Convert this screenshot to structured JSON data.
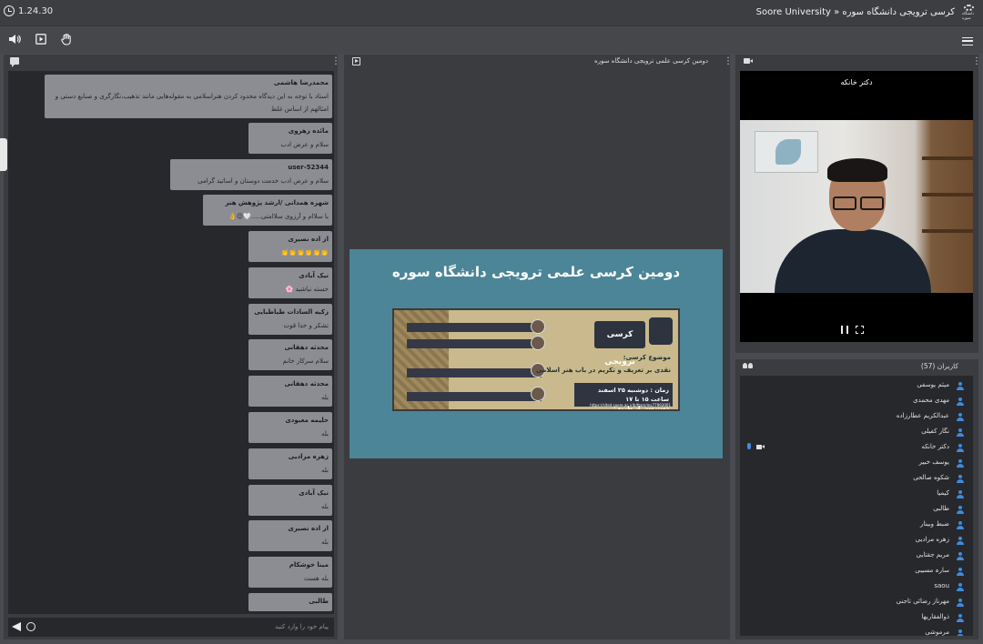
{
  "topbar": {
    "timer": "1.24.30",
    "title": "Soore University » کرسی ترویجی دانشگاه سوره",
    "logo_caption": "دانشگاه سوره"
  },
  "toolbar": {
    "speaker_icon": "speaker-icon",
    "share_icon": "screen-share-icon",
    "hand_icon": "raise-hand-icon",
    "menu_icon": "menu-icon"
  },
  "chat": {
    "input_placeholder": "پیام خود را وارد کنید",
    "messages": [
      {
        "sender": "محمدرضا هاشمی",
        "text": "استاد با توجه به این دیدگاه محدود کردن هنراسلامی به مقوله‌هایی مانند تذهیب،نگارگری و صنایع دستی و امثالهم از اساس غلط"
      },
      {
        "sender": "مائده زهروی",
        "text": "سلام و عرض ادب"
      },
      {
        "sender": "user-52344",
        "text": "سلام و عرض ادب خدمت دوستان و اساتید گرامی"
      },
      {
        "sender": "شهره همدانی /ارشد پژوهش هنر",
        "text": "با سلاام و آرزوی سلاامتی.....🤍😌👌"
      },
      {
        "sender": "از اده نصیری",
        "text": "👏👏👏👏👏👏"
      },
      {
        "sender": "نیک آبادی",
        "text": "خسته نباشید 🌸"
      },
      {
        "sender": "زکیه السادات طباطبایی",
        "text": "تشکر و خدا قوت"
      },
      {
        "sender": "محدثه دهقانی",
        "text": "سلام سرکار خانم"
      },
      {
        "sender": "محدثه دهقانی",
        "text": "بله"
      },
      {
        "sender": "حلیمه معبودی",
        "text": "بله"
      },
      {
        "sender": "زهره مرادیی",
        "text": "بله"
      },
      {
        "sender": "نیک آبادی",
        "text": "بله"
      },
      {
        "sender": "از اده نصیری",
        "text": "بله"
      },
      {
        "sender": "مینا خوشکام",
        "text": "بله هست"
      },
      {
        "sender": "طالبی",
        "text": ""
      }
    ]
  },
  "presentation": {
    "title": "دومین کرسی علمی ترویجی دانشگاه سوره",
    "slide_title": "دومین کرسی علمی ترویجی دانشگاه سوره",
    "banner_heading": "کرسی ترویجی",
    "banner_subject": "موضوع کرسی:",
    "banner_topic": "نقدی بر تعریف و تکریم در باب هنر اسلامی",
    "banner_time": "زمان : دوشنبه ۲۵ اسفند ساعت ۱۵ تا ۱۷",
    "banner_access": "دسترسی از طریق:",
    "banner_link": "https://slted.soore.ac.ir/b/ttam/ms77993001"
  },
  "webcam": {
    "name": "دکتر خانکه"
  },
  "users": {
    "title": "کاربران (57)",
    "list": [
      {
        "name": "میثم یوسفی",
        "has_av": false
      },
      {
        "name": "مهدی محمدی",
        "has_av": false
      },
      {
        "name": "عبدالکریم عطارزاده",
        "has_av": false
      },
      {
        "name": "نگار کفیلی",
        "has_av": false
      },
      {
        "name": "دکتر خانکه",
        "has_av": true
      },
      {
        "name": "یوسف خبیر",
        "has_av": false
      },
      {
        "name": "شکوه صالحی",
        "has_av": false
      },
      {
        "name": "کیمیا",
        "has_av": false
      },
      {
        "name": "طالبی",
        "has_av": false
      },
      {
        "name": "ضبط وبینار",
        "has_av": false
      },
      {
        "name": "زهره مرادیی",
        "has_av": false
      },
      {
        "name": "مریم جقتایی",
        "has_av": false
      },
      {
        "name": "سارہ مسیبی",
        "has_av": false
      },
      {
        "name": "saou",
        "has_av": false
      },
      {
        "name": "مهرناز رضائی تاجنی",
        "has_av": false
      },
      {
        "name": "ذوالفقاریها",
        "has_av": false
      },
      {
        "name": "مرموشی",
        "has_av": false
      }
    ]
  }
}
